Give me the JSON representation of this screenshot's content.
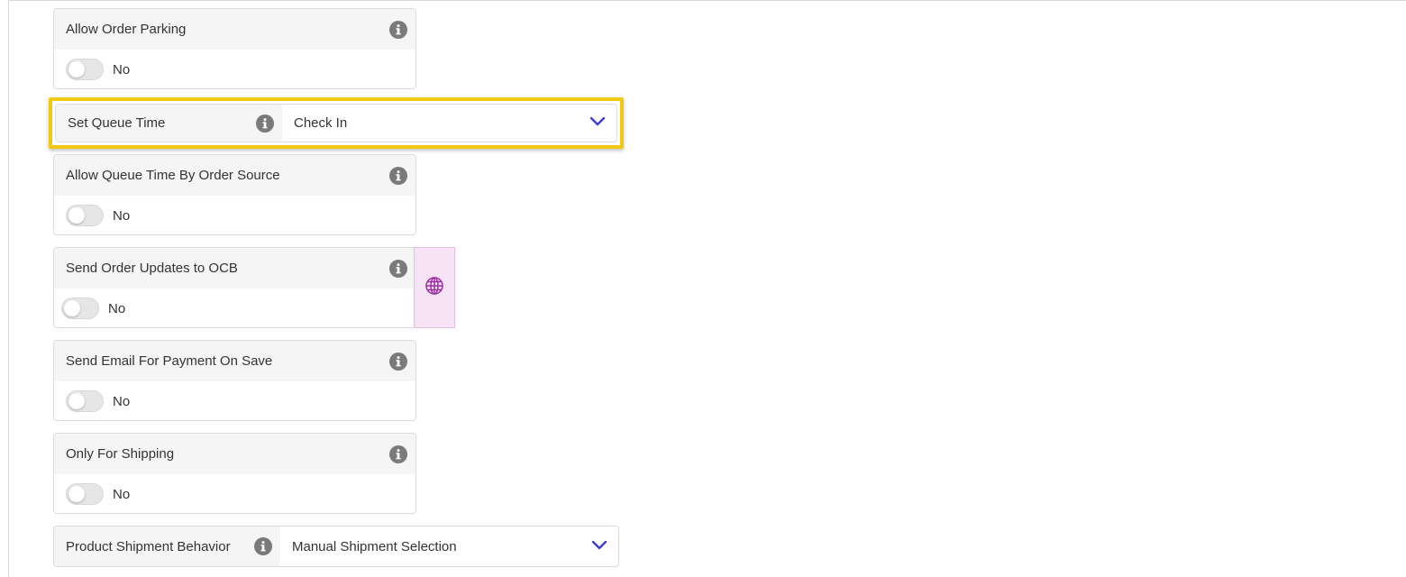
{
  "colors": {
    "highlight": "#f2c811",
    "chevron": "#3b3bd8",
    "globe": "#9b2ea0",
    "info_icon": "#7a7a7a"
  },
  "settings": {
    "allow_order_parking": {
      "title": "Allow Order Parking",
      "value_label": "No",
      "enabled": false,
      "icon": "info-icon"
    },
    "set_queue_time": {
      "title": "Set Queue Time",
      "selected": "Check In",
      "icon": "chevron-down-icon"
    },
    "allow_queue_time_by_order_source": {
      "title": "Allow Queue Time By Order Source",
      "value_label": "No",
      "enabled": false
    },
    "send_order_updates_to_ocb": {
      "title": "Send Order Updates to OCB",
      "value_label": "No",
      "enabled": false,
      "side_icon": "globe-icon"
    },
    "send_email_for_payment_on_save": {
      "title": "Send Email For Payment On Save",
      "value_label": "No",
      "enabled": false
    },
    "only_for_shipping": {
      "title": "Only For Shipping",
      "value_label": "No",
      "enabled": false
    },
    "product_shipment_behavior": {
      "title": "Product Shipment Behavior",
      "selected": "Manual Shipment Selection"
    }
  }
}
